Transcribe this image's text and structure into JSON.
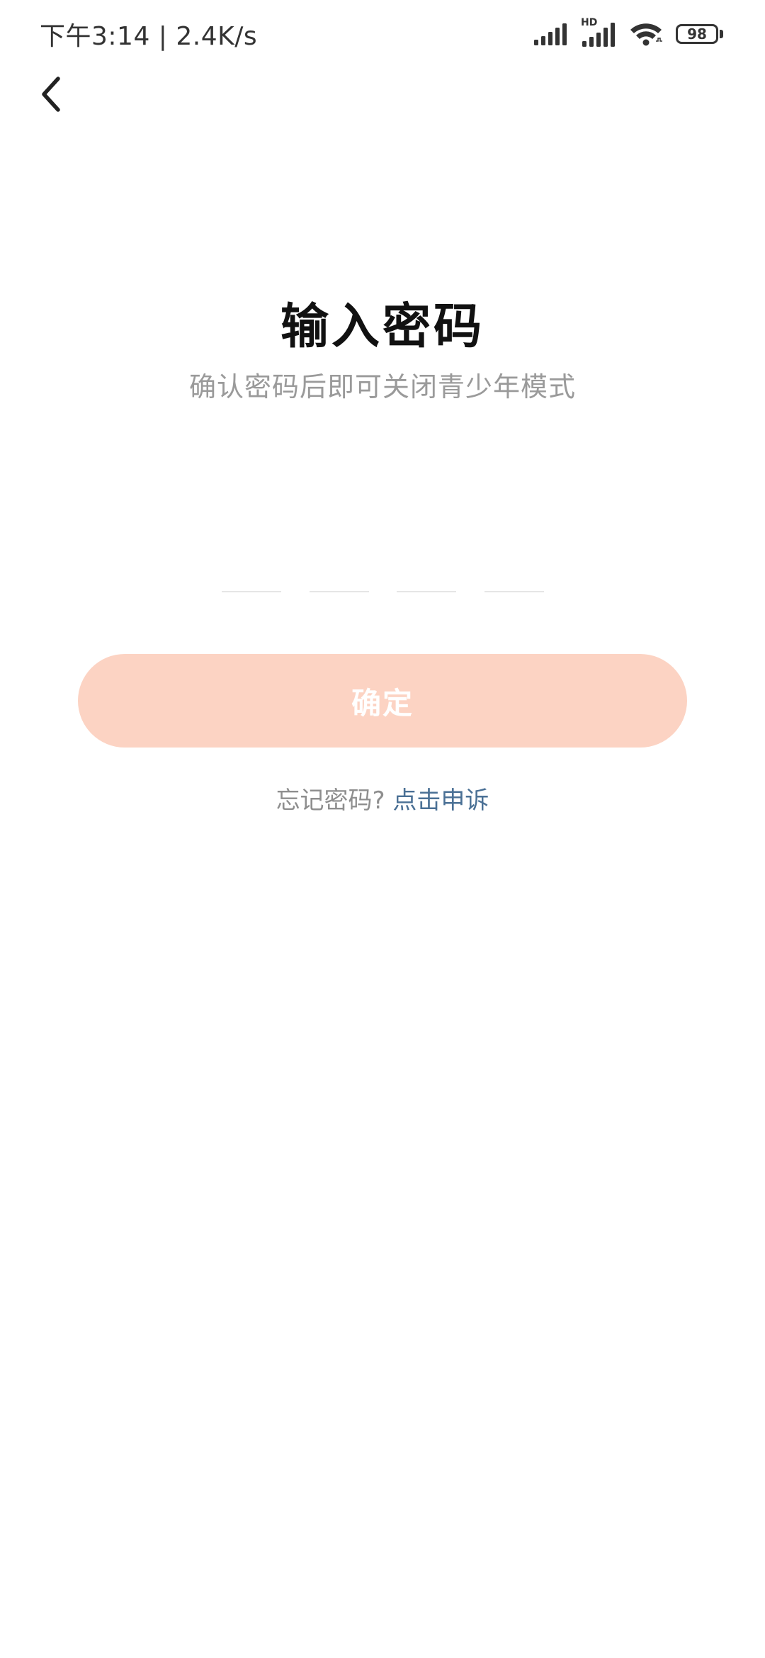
{
  "status_bar": {
    "time_and_speed": "下午3:14 | 2.4K/s",
    "network_badge": "HD",
    "battery_level": "98",
    "icons": [
      "signal-icon",
      "hd-signal-icon",
      "wifi-icon",
      "battery-icon"
    ]
  },
  "nav": {
    "back_icon": "chevron-left-icon"
  },
  "main": {
    "title": "输入密码",
    "subtitle": "确认密码后即可关闭青少年模式",
    "pin_slots": [
      "",
      "",
      "",
      ""
    ],
    "confirm_label": "确定",
    "forgot_prefix": "忘记密码?",
    "appeal_link": "点击申诉"
  },
  "colors": {
    "confirm_button_bg": "#fcd3c3",
    "link": "#4a7095",
    "subtitle": "#9a9a9a"
  }
}
